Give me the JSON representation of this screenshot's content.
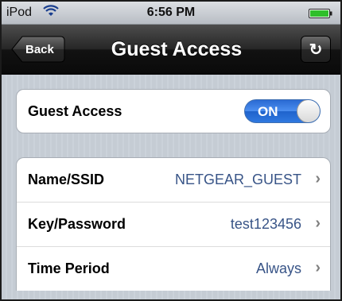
{
  "status_bar": {
    "carrier": "iPod",
    "wifi_icon": "wifi-icon",
    "time": "6:56 PM",
    "battery_icon": "battery-icon",
    "battery_color": "#2fbf2a"
  },
  "nav_bar": {
    "back_label": "Back",
    "title": "Guest Access",
    "refresh_icon": "refresh-icon",
    "refresh_glyph": "↻"
  },
  "guest_access_group": {
    "label": "Guest Access",
    "toggle": {
      "state_label": "ON",
      "on": true,
      "color": "#2f78e0"
    }
  },
  "details_group": {
    "rows": [
      {
        "label": "Name/SSID",
        "value": "NETGEAR_GUEST",
        "chevron": "›"
      },
      {
        "label": "Key/Password",
        "value": "test123456",
        "chevron": "›"
      },
      {
        "label": "Time Period",
        "value": "Always",
        "chevron": "›"
      }
    ],
    "value_color": "#385487"
  }
}
